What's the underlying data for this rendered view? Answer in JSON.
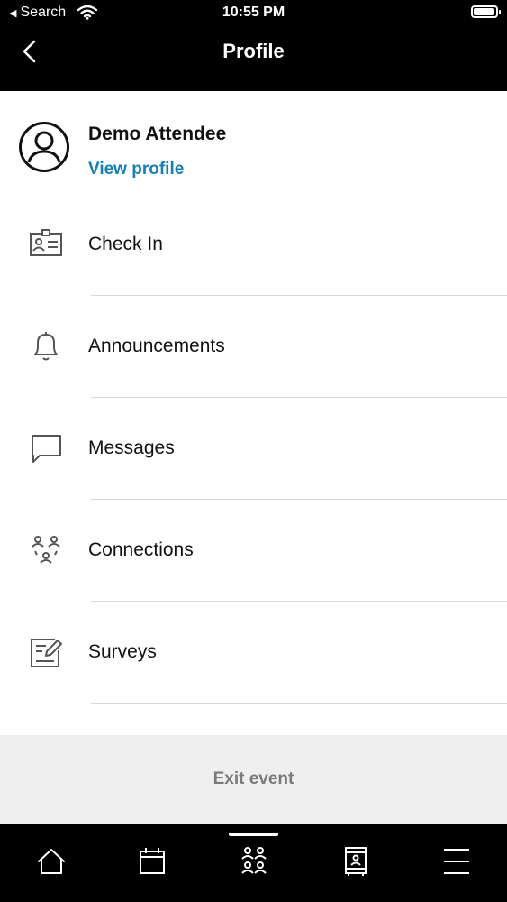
{
  "status_bar": {
    "back_app": "Search",
    "time": "10:55 PM",
    "battery_level": 0.95
  },
  "header": {
    "title": "Profile",
    "back_icon": "chevron-left-icon"
  },
  "profile": {
    "name": "Demo Attendee",
    "link_label": "View profile",
    "link_color": "#1580b8",
    "avatar_icon": "user-circle-icon"
  },
  "menu": {
    "items": [
      {
        "label": "Check In",
        "icon": "id-badge-icon"
      },
      {
        "label": "Announcements",
        "icon": "bell-icon"
      },
      {
        "label": "Messages",
        "icon": "chat-bubble-icon"
      },
      {
        "label": "Connections",
        "icon": "people-network-icon"
      },
      {
        "label": "Surveys",
        "icon": "survey-edit-icon"
      }
    ]
  },
  "exit": {
    "label": "Exit event"
  },
  "tabbar": {
    "tabs": [
      {
        "icon": "home-icon"
      },
      {
        "icon": "calendar-icon"
      },
      {
        "icon": "people-icon",
        "selected": true
      },
      {
        "icon": "booth-icon"
      },
      {
        "icon": "menu-icon"
      }
    ]
  }
}
